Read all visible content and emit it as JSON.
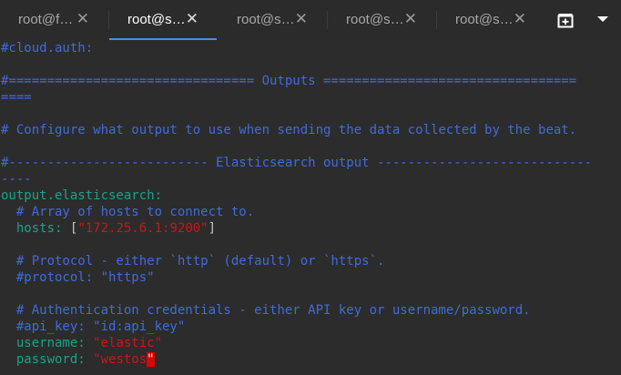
{
  "tabs": [
    {
      "label": "root@f…",
      "close": "✕",
      "active": false
    },
    {
      "label": "root@s…",
      "close": "✕",
      "active": true
    },
    {
      "label": "root@s…",
      "close": "✕",
      "active": false
    },
    {
      "label": "root@s…",
      "close": "✕",
      "active": false
    },
    {
      "label": "root@s…",
      "close": "✕",
      "active": false
    }
  ],
  "icons": {
    "new_tab": "new-tab-icon",
    "menu": "chevron-down-icon"
  },
  "colors": {
    "comment": "#3f6bdc",
    "key": "#19a38a",
    "string": "#d01515",
    "active_tab_underline": "#4a90d9",
    "cursor": "#e00000"
  },
  "terminal": {
    "l1": "#cloud.auth:",
    "l2": "#================================ Outputs =================================",
    "l3": "====",
    "l4": "# Configure what output to use when sending the data collected by the beat.",
    "l5": "#-------------------------- Elasticsearch output ----------------------------",
    "l6": "----",
    "l7": "output.elasticsearch:",
    "l8": "  # Array of hosts to connect to.",
    "l9_key": "  hosts",
    "l9_colon": ": ",
    "l9_open": "[",
    "l9_val": "\"172.25.6.1:9200\"",
    "l9_close": "]",
    "l10": "  # Protocol - either `http` (default) or `https`.",
    "l11": "  #protocol: \"https\"",
    "l12": "  # Authentication credentials - either API key or username/password.",
    "l13": "  #api_key: \"id:api_key\"",
    "l14_key": "  username",
    "l14_colon": ": ",
    "l14_val": "\"elastic\"",
    "l15_key": "  password",
    "l15_colon": ": ",
    "l15_val": "\"westos",
    "l15_cursor": "\""
  }
}
